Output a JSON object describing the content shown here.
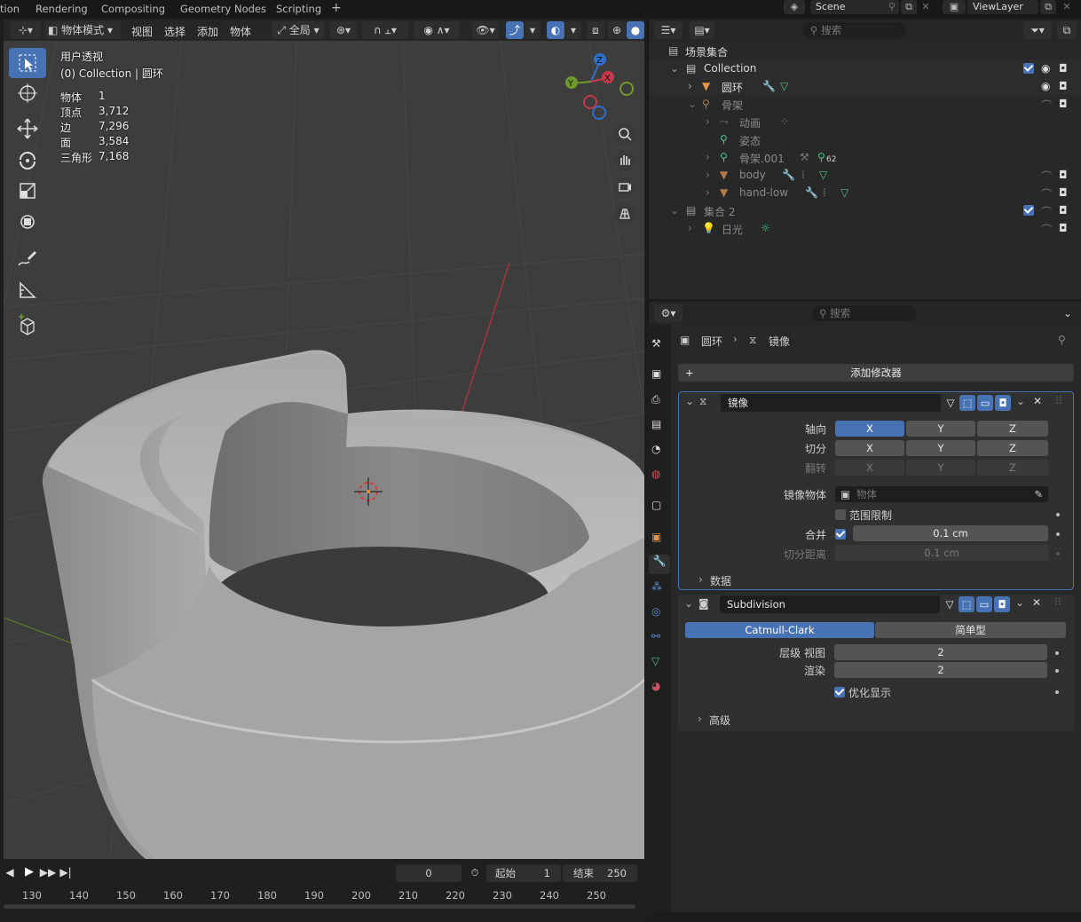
{
  "topbar": {
    "tabs": [
      "tion",
      "Rendering",
      "Compositing",
      "Geometry Nodes",
      "Scripting"
    ],
    "add_tab": "+",
    "scene": "Scene",
    "view_layer": "ViewLayer"
  },
  "viewport_header": {
    "mode": "物体模式",
    "menus": [
      "视图",
      "选择",
      "添加",
      "物体"
    ],
    "orientation": "全局"
  },
  "viewport": {
    "view_name": "用户透视",
    "collection_line": "(0) Collection | 圆环",
    "stats": [
      {
        "label": "物体",
        "value": "1"
      },
      {
        "label": "顶点",
        "value": "3,712"
      },
      {
        "label": "边",
        "value": "7,296"
      },
      {
        "label": "面",
        "value": "3,584"
      },
      {
        "label": "三角形",
        "value": "7,168"
      }
    ],
    "gizmo": {
      "x": "X",
      "y": "Y",
      "z": "Z"
    }
  },
  "timeline": {
    "current_frame": "0",
    "start_label": "起始",
    "start_value": "1",
    "end_label": "结束",
    "end_value": "250",
    "ticks": [
      "130",
      "140",
      "150",
      "160",
      "170",
      "180",
      "190",
      "200",
      "210",
      "220",
      "230",
      "240",
      "250"
    ]
  },
  "outliner": {
    "search_placeholder": "搜索",
    "rows": [
      {
        "label": "场景集合"
      },
      {
        "label": "Collection"
      },
      {
        "label": "圆环"
      },
      {
        "label": "骨架"
      },
      {
        "label": "动画"
      },
      {
        "label": "姿态"
      },
      {
        "label": "骨架.001"
      },
      {
        "label": "body"
      },
      {
        "label": "hand-low"
      },
      {
        "label": "集合 2"
      },
      {
        "label": "日光"
      }
    ],
    "badge_62": "62"
  },
  "properties": {
    "search_placeholder": "搜索",
    "breadcrumb_object": "圆环",
    "breadcrumb_modifier": "镜像",
    "add_modifier": "添加修改器",
    "mirror": {
      "name": "镜像",
      "axis_label": "轴向",
      "bisect_label": "切分",
      "flip_label": "翻转",
      "x": "X",
      "y": "Y",
      "z": "Z",
      "mirror_object_label": "镜像物体",
      "mirror_object_placeholder": "物体",
      "clipping_label": "范围限制",
      "merge_label": "合并",
      "merge_value": "0.1 cm",
      "bisect_distance_label": "切分距离",
      "bisect_distance_value": "0.1 cm",
      "data_label": "数据"
    },
    "subdivision": {
      "name": "Subdivision",
      "catmull": "Catmull-Clark",
      "simple": "简单型",
      "levels_viewport_label": "层级 视图",
      "levels_viewport_value": "2",
      "render_label": "渲染",
      "render_value": "2",
      "optimal_label": "优化显示",
      "advanced_label": "高级"
    }
  },
  "colors": {
    "accent": "#4772b3",
    "x_axis": "#c8384b",
    "y_axis": "#6f9a2d",
    "z_axis": "#2f6fc9"
  }
}
